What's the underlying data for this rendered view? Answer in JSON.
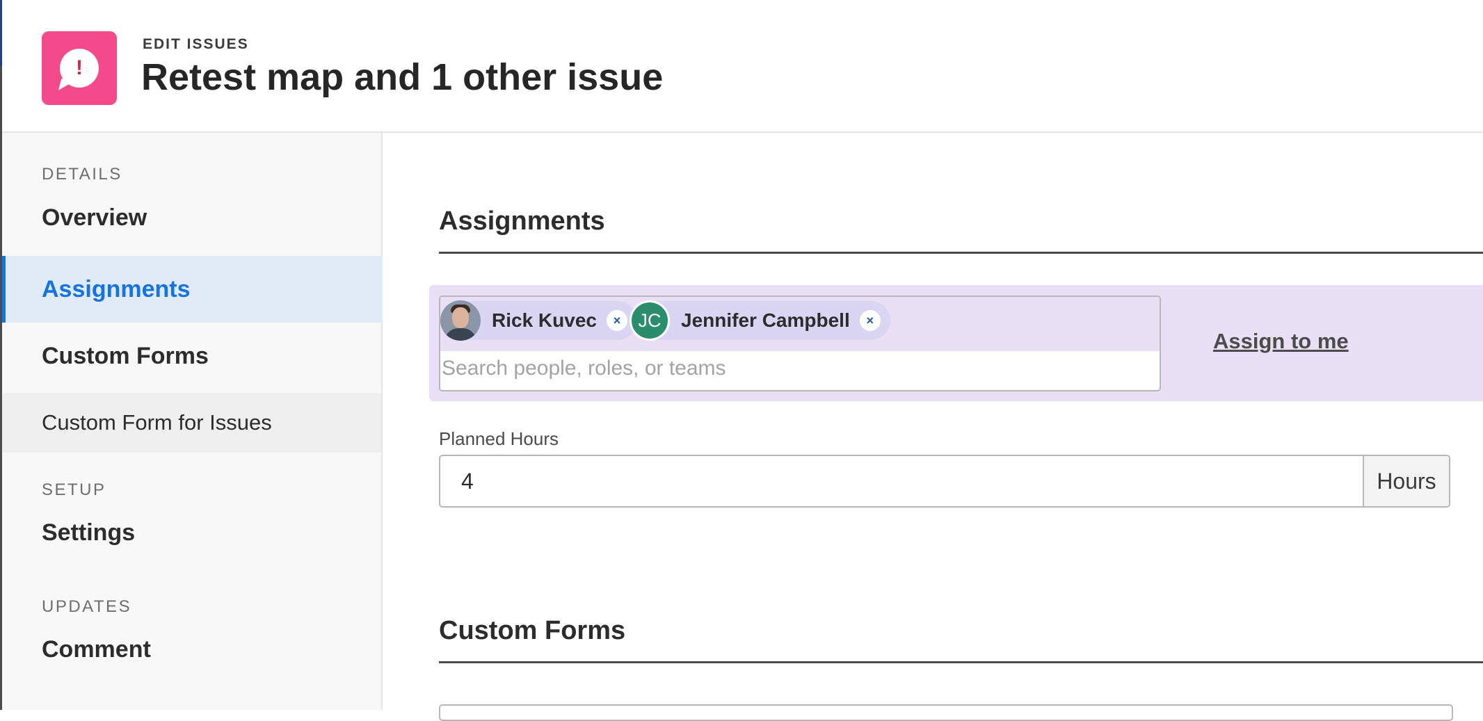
{
  "header": {
    "eyebrow": "EDIT ISSUES",
    "title": "Retest map and 1 other issue",
    "icon": "issue-bubble-icon",
    "icon_glyph": "!",
    "icon_color": "#f4498b"
  },
  "sidebar": {
    "sections": {
      "details": "DETAILS",
      "setup": "SETUP",
      "updates": "UPDATES"
    },
    "items": {
      "overview": "Overview",
      "assignments": "Assignments",
      "custom_forms": "Custom Forms",
      "custom_form_for_issues": "Custom Form for Issues",
      "settings": "Settings",
      "comment": "Comment"
    },
    "active_item": "Assignments",
    "accent_color": "#1473e6"
  },
  "main": {
    "assignments": {
      "title": "Assignments",
      "assignees": [
        {
          "name": "Rick Kuvec",
          "avatar": "photo"
        },
        {
          "name": "Jennifer Campbell",
          "avatar_initials": "JC",
          "avatar_color": "#2a8d6c"
        }
      ],
      "remove_glyph": "×",
      "search_placeholder": "Search people, roles, or teams",
      "search_value": "",
      "assign_to_me": "Assign to me"
    },
    "planned_hours": {
      "label": "Planned Hours",
      "value": "4",
      "unit": "Hours"
    },
    "custom_forms": {
      "title": "Custom Forms"
    }
  }
}
